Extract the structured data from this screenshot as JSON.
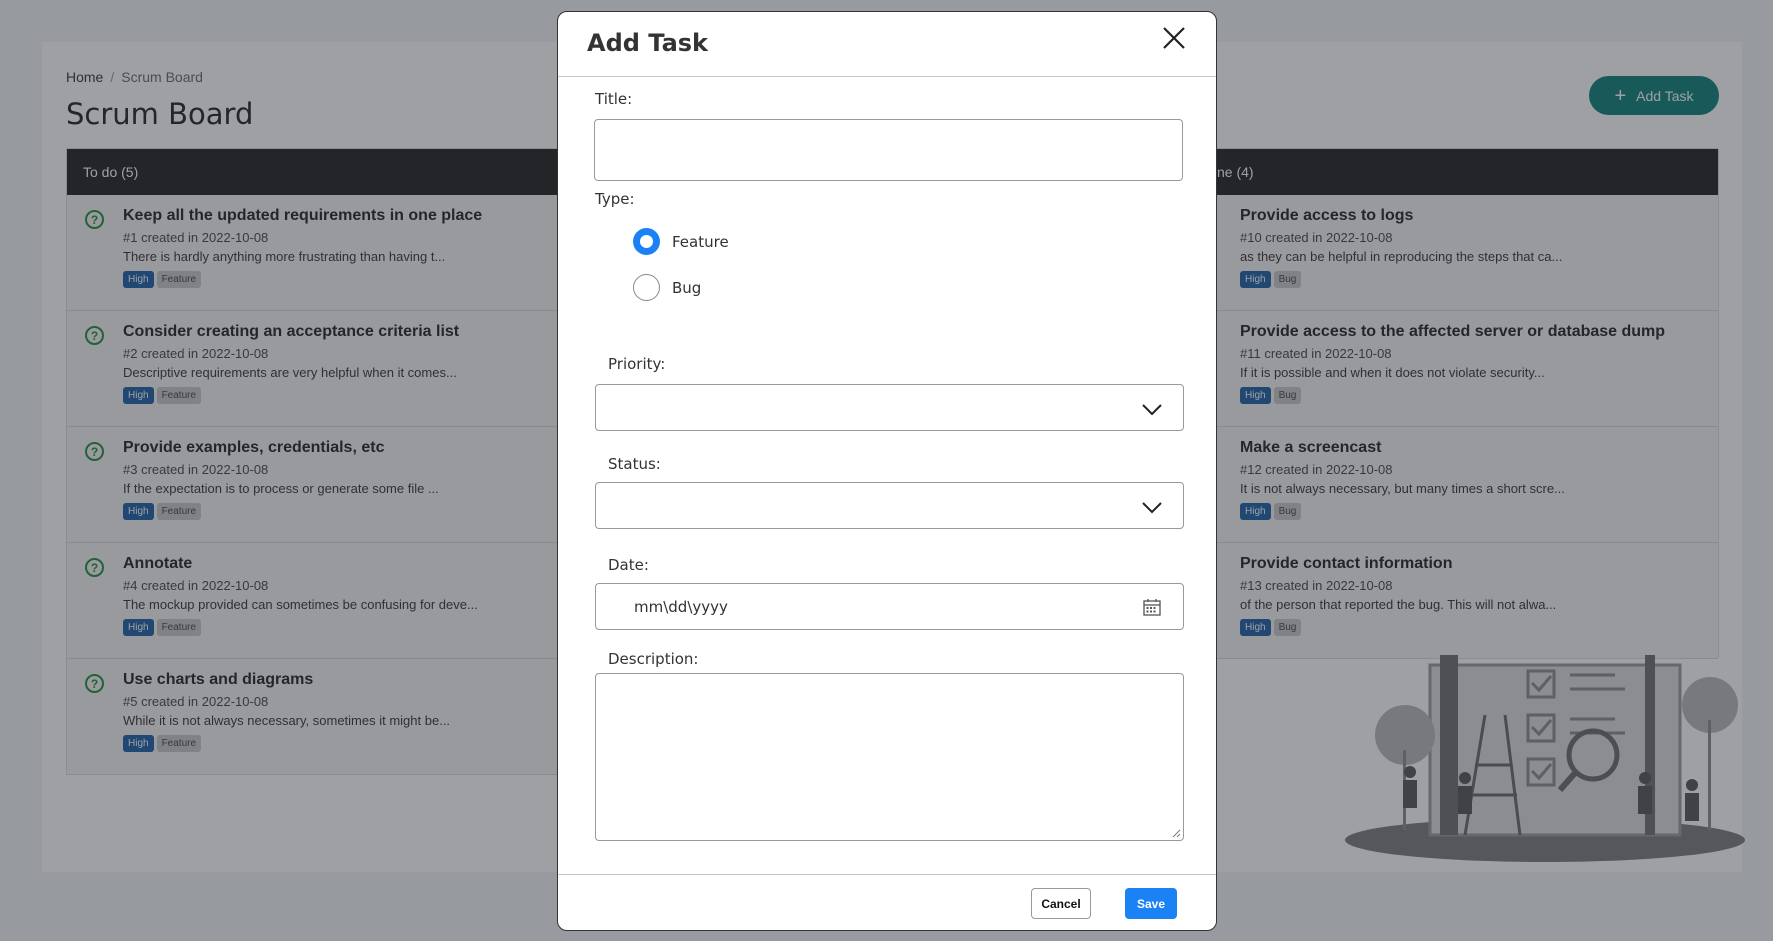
{
  "breadcrumb": {
    "home": "Home",
    "separator": "/",
    "current": "Scrum Board"
  },
  "page": {
    "title": "Scrum Board",
    "add_task_label": "Add Task"
  },
  "columns": {
    "todo": {
      "header": "To do (5)",
      "cards": [
        {
          "title": "Keep all the updated requirements in one place",
          "meta": "#1 created in 2022-10-08",
          "desc": "There is hardly anything more frustrating than having t...",
          "priority": "High",
          "type": "Feature"
        },
        {
          "title": "Consider creating an acceptance criteria list",
          "meta": "#2 created in 2022-10-08",
          "desc": "Descriptive requirements are very helpful when it comes...",
          "priority": "High",
          "type": "Feature"
        },
        {
          "title": "Provide examples, credentials, etc",
          "meta": "#3 created in 2022-10-08",
          "desc": "If the expectation is to process or generate some file ...",
          "priority": "High",
          "type": "Feature"
        },
        {
          "title": "Annotate",
          "meta": "#4 created in 2022-10-08",
          "desc": "The mockup provided can sometimes be confusing for deve...",
          "priority": "High",
          "type": "Feature"
        },
        {
          "title": "Use charts and diagrams",
          "meta": "#5 created in 2022-10-08",
          "desc": "While it is not always necessary, sometimes it might be...",
          "priority": "High",
          "type": "Feature"
        }
      ]
    },
    "done": {
      "header": "ne (4)",
      "cards": [
        {
          "title": "Provide access to logs",
          "meta": "#10 created in 2022-10-08",
          "desc": "as they can be helpful in reproducing the steps that ca...",
          "priority": "High",
          "type": "Bug"
        },
        {
          "title": "Provide access to the affected server or database dump",
          "meta": "#11 created in 2022-10-08",
          "desc": "If it is possible and when it does not violate security...",
          "priority": "High",
          "type": "Bug"
        },
        {
          "title": "Make a screencast",
          "meta": "#12 created in 2022-10-08",
          "desc": "It is not always necessary, but many times a short scre...",
          "priority": "High",
          "type": "Bug"
        },
        {
          "title": "Provide contact information",
          "meta": "#13 created in 2022-10-08",
          "desc": "of the person that reported the bug. This will not alwa...",
          "priority": "High",
          "type": "Bug"
        }
      ]
    }
  },
  "modal": {
    "title": "Add Task",
    "title_label": "Title:",
    "title_value": "",
    "type_label": "Type:",
    "type_options": [
      "Feature",
      "Bug"
    ],
    "type_selected": "Feature",
    "priority_label": "Priority:",
    "priority_value": "",
    "status_label": "Status:",
    "status_value": "",
    "date_label": "Date:",
    "date_placeholder": "mm\\dd\\yyyy",
    "description_label": "Description:",
    "description_value": "",
    "cancel_label": "Cancel",
    "save_label": "Save"
  },
  "colors": {
    "accent": "#1a82f5",
    "add_button": "#0a8079",
    "header_bar": "#1f1f1f",
    "priority_tag": "#1d5fa8",
    "question_icon": "#1f8f3a"
  }
}
